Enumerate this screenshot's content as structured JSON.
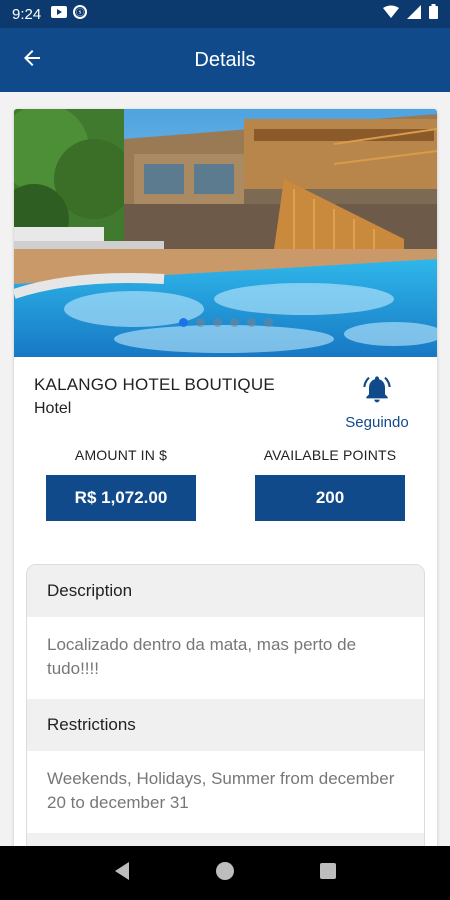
{
  "status_bar": {
    "time": "9:24"
  },
  "app_bar": {
    "title": "Details"
  },
  "hotel": {
    "name": "KALANGO HOTEL BOUTIQUE",
    "type": "Hotel",
    "follow_label": "Seguindo"
  },
  "carousel": {
    "total": 6,
    "active_index": 0
  },
  "stats": {
    "amount_label": "AMOUNT IN $",
    "amount_value": "R$ 1,072.00",
    "points_label": "AVAILABLE POINTS",
    "points_value": "200"
  },
  "sections": {
    "description_title": "Description",
    "description_text": "Localizado dentro da mata, mas perto de tudo!!!!",
    "restrictions_title": "Restrictions",
    "restrictions_text": "Weekends, Holidays, Summer from december 20 to december 31"
  },
  "colors": {
    "primary": "#114a8b",
    "status_bar": "#0d3a6e",
    "dot_active": "#1a73e8"
  }
}
